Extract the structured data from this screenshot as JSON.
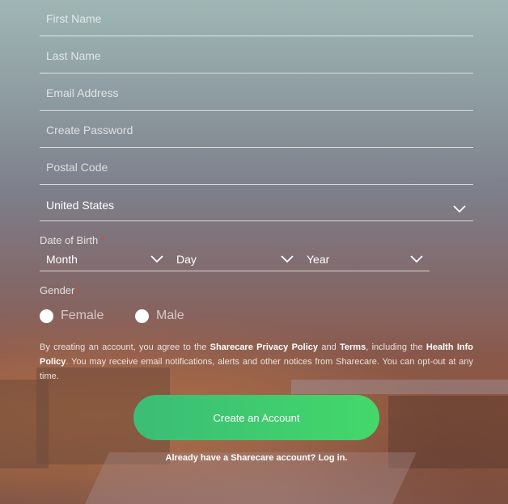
{
  "form": {
    "first_name": {
      "placeholder": "First Name",
      "value": ""
    },
    "last_name": {
      "placeholder": "Last Name",
      "value": ""
    },
    "email": {
      "placeholder": "Email Address",
      "value": ""
    },
    "password": {
      "placeholder": "Create Password",
      "value": ""
    },
    "postal_code": {
      "placeholder": "Postal Code",
      "value": ""
    },
    "country": {
      "selected": "United States"
    },
    "dob": {
      "label": "Date of Birth",
      "required_mark": "*",
      "month": "Month",
      "day": "Day",
      "year": "Year"
    },
    "gender": {
      "label": "Gender",
      "required_mark": "*",
      "options": [
        "Female",
        "Male"
      ]
    },
    "terms": {
      "prefix": "By creating an account, you agree to the ",
      "privacy_link": "Sharecare Privacy Policy",
      "and": " and ",
      "terms_link": "Terms",
      "including": ", including the ",
      "health_link": "Health Info Policy",
      "suffix": ". You may receive email notifications, alerts and other notices from Sharecare. You can opt-out at any time."
    },
    "submit_label": "Create an Account",
    "login": {
      "prefix": "Already have a Sharecare account? ",
      "link": "Log in."
    }
  },
  "colors": {
    "button_start": "#3bbd76",
    "button_end": "#43d86a",
    "required": "#e2413a"
  }
}
